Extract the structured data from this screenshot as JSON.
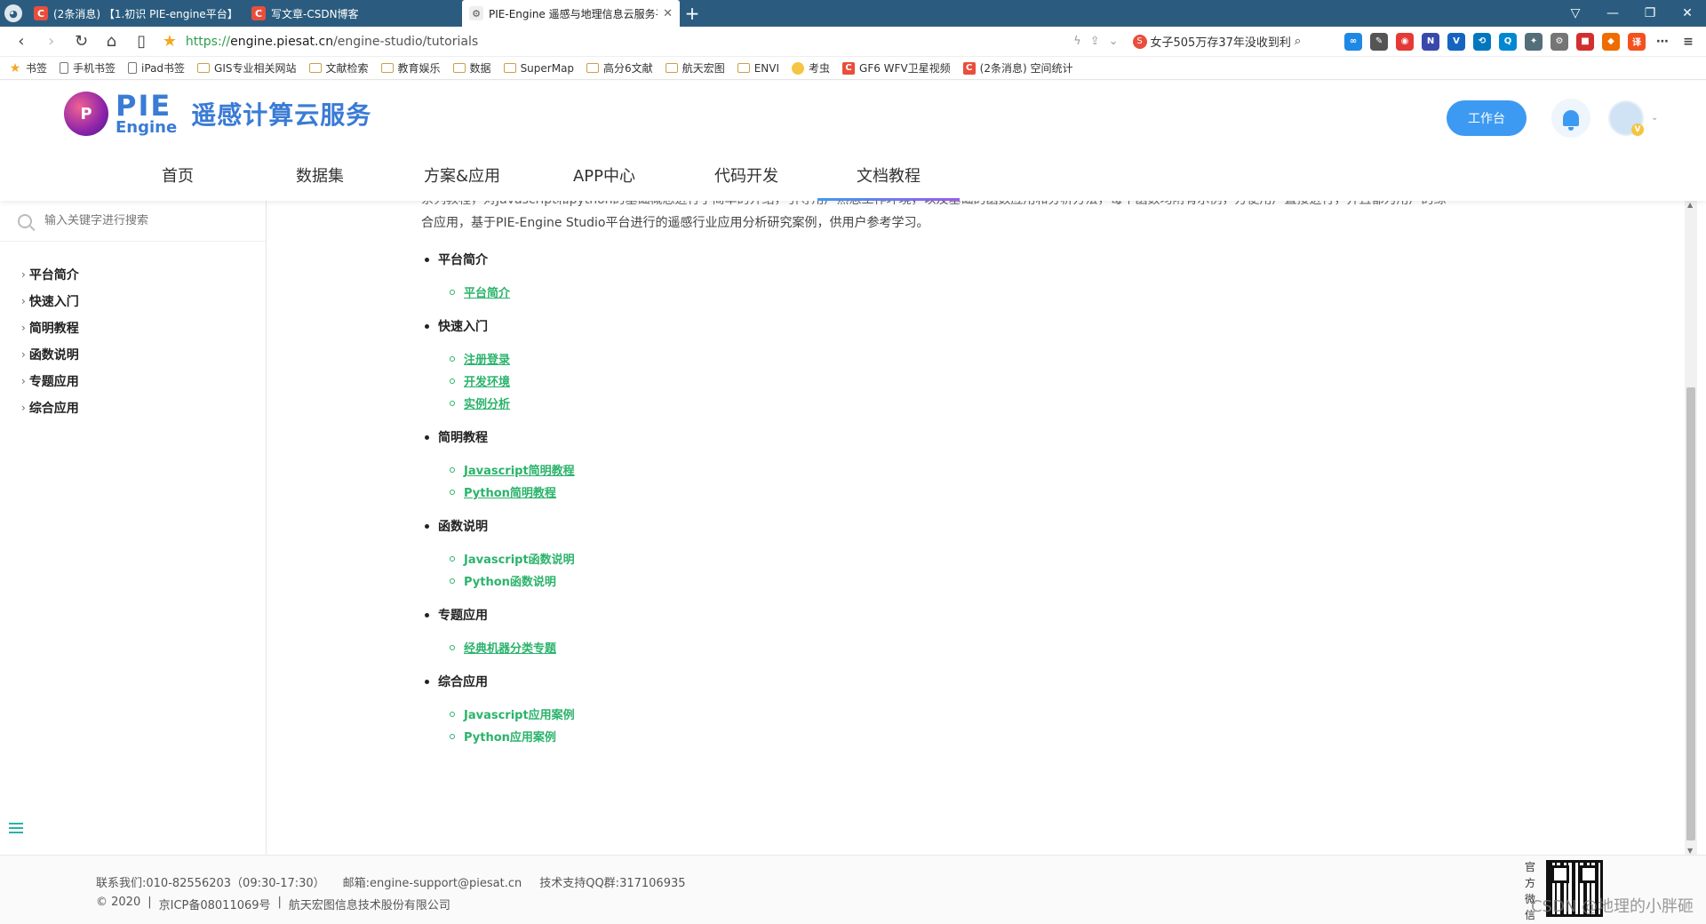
{
  "browser": {
    "tabs": [
      {
        "label": "(2条消息) 【1.初识 PIE-engine平台】",
        "favicon": "C",
        "active": false
      },
      {
        "label": "写文章-CSDN博客",
        "favicon": "C",
        "active": false
      },
      {
        "label": "PIE-Engine 遥感与地理信息云服务平",
        "favicon": "ie",
        "active": true
      }
    ],
    "url": {
      "proto": "https://",
      "host": "engine.piesat.cn",
      "path": "/engine-studio/tutorials"
    },
    "search_text": "女子505万存37年没收到利",
    "bookmarks": [
      "书签",
      "手机书签",
      "iPad书签",
      "GIS专业相关网站",
      "文献检索",
      "教育娱乐",
      "数据",
      "SuperMap",
      "高分6文献",
      "航天宏图",
      "ENVI",
      "考虫",
      "GF6 WFV卫星视频",
      "(2条消息) 空间统计"
    ]
  },
  "site": {
    "logo_word_top": "PIE",
    "logo_word_bottom": "Engine",
    "logo_title": "遥感计算云服务",
    "workbench_label": "工作台",
    "nav": [
      "首页",
      "数据集",
      "方案&应用",
      "APP中心",
      "代码开发",
      "文档教程"
    ],
    "nav_active": "文档教程",
    "avatar_badge": "V"
  },
  "sidebar": {
    "search_placeholder": "输入关键字进行搜索",
    "items": [
      "平台简介",
      "快速入门",
      "简明教程",
      "函数说明",
      "专题应用",
      "综合应用"
    ]
  },
  "content": {
    "intro_line1": "系列教程，对Javascript和python的基础概念进行了简单的介绍，引导用户熟悉工作环境，以及基础的函数应用和分析方法，每个函数均附有示例，方便用户直接进行，并且都为用户的综",
    "intro_line2": "合应用，基于PIE-Engine Studio平台进行的遥感行业应用分析研究案例，供用户参考学习。",
    "sections": [
      {
        "title": "平台简介",
        "links": [
          {
            "text": "平台简介",
            "underline": true
          }
        ]
      },
      {
        "title": "快速入门",
        "links": [
          {
            "text": "注册登录",
            "underline": true
          },
          {
            "text": "开发环境",
            "underline": true
          },
          {
            "text": "实例分析",
            "underline": true
          }
        ]
      },
      {
        "title": "简明教程",
        "links": [
          {
            "text": "Javascript简明教程",
            "underline": true
          },
          {
            "text": "Python简明教程",
            "underline": true
          }
        ]
      },
      {
        "title": "函数说明",
        "links": [
          {
            "text": "Javascript函数说明",
            "underline": false
          },
          {
            "text": "Python函数说明",
            "underline": false
          }
        ]
      },
      {
        "title": "专题应用",
        "links": [
          {
            "text": "经典机器分类专题",
            "underline": true
          }
        ]
      },
      {
        "title": "综合应用",
        "links": [
          {
            "text": "Javascript应用案例",
            "underline": false
          },
          {
            "text": "Python应用案例",
            "underline": false
          }
        ]
      }
    ]
  },
  "footer": {
    "contact": "联系我们:010-82556203（09:30-17:30）",
    "email": "邮箱:engine-support@piesat.cn",
    "qq": "技术支持QQ群:317106935",
    "copyright": "© 2020",
    "icp": "京ICP备08011069号",
    "company": "航天宏图信息技术股份有限公司",
    "wechat_label": "官方微信"
  },
  "watermark": "CSDN @地理的小胖砸",
  "colors": {
    "accent": "#3d9af2",
    "link_green": "#2bb36b",
    "tabbar": "#2b5c7f"
  }
}
